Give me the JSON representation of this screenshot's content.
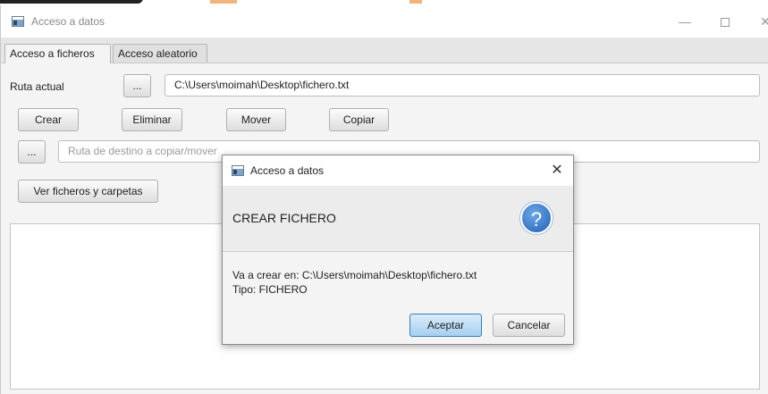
{
  "window": {
    "title": "Acceso a datos",
    "controls": {
      "minimize": "—",
      "close": "✕"
    }
  },
  "tabs": [
    {
      "label": "Acceso a ficheros",
      "active": true
    },
    {
      "label": "Acceso aleatorio",
      "active": false
    }
  ],
  "path_row": {
    "label": "Ruta actual",
    "browse_label": "...",
    "value": "C:\\Users\\moimah\\Desktop\\fichero.txt"
  },
  "actions": {
    "create": "Crear",
    "delete": "Eliminar",
    "move": "Mover",
    "copy": "Copiar"
  },
  "destination": {
    "browse_label": "...",
    "placeholder": "Ruta de destino a copiar/mover"
  },
  "view_button": "Ver ficheros y carpetas",
  "dialog": {
    "title": "Acceso a datos",
    "close_symbol": "✕",
    "header": "CREAR FICHERO",
    "icon": "question-icon",
    "icon_glyph": "?",
    "content_lines": [
      "Va a crear en: C:\\Users\\moimah\\Desktop\\fichero.txt",
      "Tipo: FICHERO"
    ],
    "accept": "Aceptar",
    "cancel": "Cancelar"
  },
  "colors": {
    "window_bg": "#f4f4f4",
    "accent_button": "#a7cfee",
    "question_icon": "#1f5fb2"
  }
}
